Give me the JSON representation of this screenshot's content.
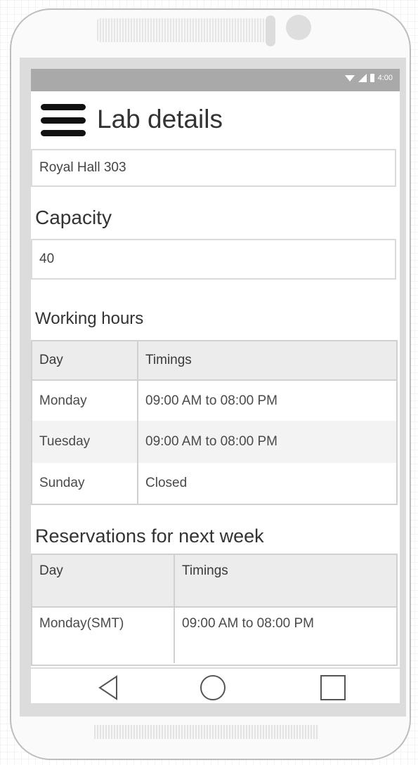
{
  "status_bar": {
    "time": "4:00"
  },
  "app_bar": {
    "title": "Lab details",
    "menu_icon": "hamburger-menu-icon"
  },
  "lab_name": "Royal Hall 303",
  "capacity": {
    "heading": "Capacity",
    "value": "40"
  },
  "working_hours": {
    "heading": "Working hours",
    "columns": [
      "Day",
      "Timings"
    ],
    "rows": [
      [
        "Monday",
        "09:00 AM to 08:00 PM"
      ],
      [
        "Tuesday",
        "09:00 AM to 08:00 PM"
      ],
      [
        "Sunday",
        "Closed"
      ]
    ]
  },
  "reservations": {
    "heading": "Reservations for next week",
    "columns": [
      "Day",
      "Timings"
    ],
    "rows": [
      [
        "Monday(SMT)",
        "09:00 AM to 08:00 PM"
      ]
    ]
  },
  "nav_bar": {
    "back_icon": "back-triangle-icon",
    "home_icon": "home-circle-icon",
    "recents_icon": "recents-square-icon"
  }
}
